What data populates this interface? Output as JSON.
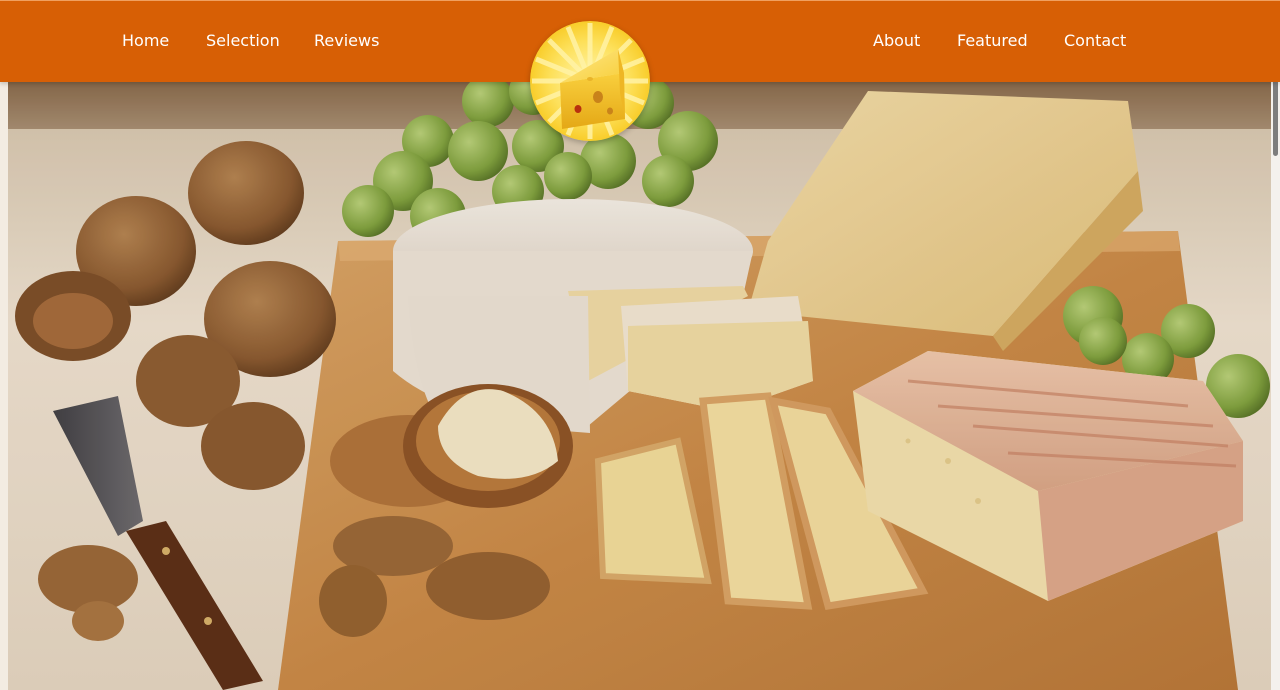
{
  "site": {
    "colors": {
      "header": "#d75f05",
      "nav_text": "#ffffff",
      "logo_yellow": "#fcd52c",
      "cheese": "#f5c842"
    }
  },
  "header": {
    "left_nav": [
      {
        "label": "Home",
        "name": "nav-home"
      },
      {
        "label": "Selection",
        "name": "nav-selection"
      },
      {
        "label": "Reviews",
        "name": "nav-reviews"
      }
    ],
    "right_nav": [
      {
        "label": "About",
        "name": "nav-about"
      },
      {
        "label": "Featured",
        "name": "nav-featured"
      },
      {
        "label": "Contact",
        "name": "nav-contact"
      }
    ],
    "logo_icon": "cheese-wedge-icon"
  },
  "hero": {
    "image_subject": "cheese-board-photo"
  }
}
